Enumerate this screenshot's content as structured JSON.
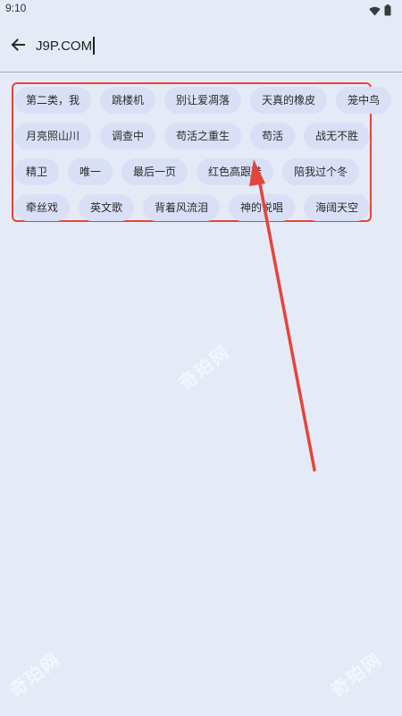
{
  "status_bar": {
    "time": "9:10",
    "icons": [
      "wifi-icon",
      "battery-icon"
    ]
  },
  "search": {
    "value": "J9P.COM",
    "back_icon": "arrow-left-icon"
  },
  "history": {
    "rows": [
      [
        "第二类，我",
        "跳楼机",
        "别让爱凋落",
        "天真的橡皮",
        "笼中鸟"
      ],
      [
        "月亮照山川",
        "调查中",
        "苟活之重生",
        "苟活",
        "战无不胜"
      ],
      [
        "精卫",
        "唯一",
        "最后一页",
        "红色高跟鞋",
        "陪我过个冬"
      ],
      [
        "牵丝戏",
        "英文歌",
        "背着风流泪",
        "神的说唱",
        "海阔天空"
      ]
    ]
  },
  "colors": {
    "background": "#e5eaf7",
    "chip": "#d9e0f6",
    "annotation": "#e4453a"
  },
  "watermark": "奇珀网"
}
